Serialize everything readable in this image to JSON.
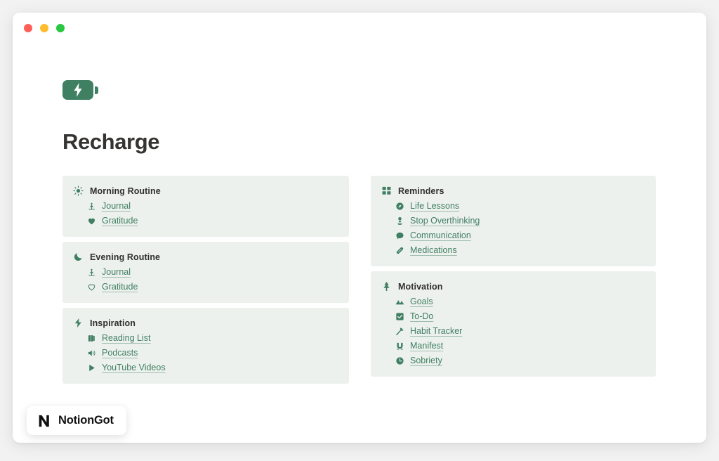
{
  "window": {
    "traffic_lights": [
      {
        "name": "close",
        "color": "#ff5f57"
      },
      {
        "name": "minimize",
        "color": "#febc2e"
      },
      {
        "name": "maximize",
        "color": "#28c840"
      }
    ]
  },
  "page": {
    "hero_icon": "battery-charging-icon",
    "title": "Recharge"
  },
  "theme": {
    "accent_green": "#3f7f62",
    "card_background": "#edf1ed",
    "title_color": "#363432",
    "page_background": "#f2f2f2"
  },
  "cards": {
    "left": [
      {
        "id": "morning-routine",
        "icon": "sun-icon",
        "title": "Morning Routine",
        "links": [
          {
            "icon": "seedling-icon",
            "label": "Journal"
          },
          {
            "icon": "heart-filled-icon",
            "label": "Gratitude"
          }
        ]
      },
      {
        "id": "evening-routine",
        "icon": "moon-icon",
        "title": "Evening Routine",
        "links": [
          {
            "icon": "seedling-icon",
            "label": "Journal"
          },
          {
            "icon": "heart-outline-icon",
            "label": "Gratitude"
          }
        ]
      },
      {
        "id": "inspiration",
        "icon": "lightning-bolt-icon",
        "title": "Inspiration",
        "links": [
          {
            "icon": "book-icon",
            "label": "Reading List"
          },
          {
            "icon": "speaker-icon",
            "label": "Podcasts"
          },
          {
            "icon": "play-icon",
            "label": "YouTube Videos"
          }
        ]
      }
    ],
    "right": [
      {
        "id": "reminders",
        "icon": "grid-icon",
        "title": "Reminders",
        "links": [
          {
            "icon": "compass-icon",
            "label": "Life Lessons"
          },
          {
            "icon": "mind-icon",
            "label": "Stop Overthinking"
          },
          {
            "icon": "chat-bubble-icon",
            "label": "Communication"
          },
          {
            "icon": "pill-icon",
            "label": "Medications"
          }
        ]
      },
      {
        "id": "motivation",
        "icon": "tree-icon",
        "title": "Motivation",
        "links": [
          {
            "icon": "mountains-icon",
            "label": "Goals"
          },
          {
            "icon": "checkbox-checked-icon",
            "label": "To-Do"
          },
          {
            "icon": "axe-icon",
            "label": "Habit Tracker"
          },
          {
            "icon": "magnet-icon",
            "label": "Manifest"
          },
          {
            "icon": "clock-icon",
            "label": "Sobriety"
          }
        ]
      }
    ]
  },
  "logo": {
    "mark": "notion-n-icon",
    "text": "NotionGot"
  }
}
